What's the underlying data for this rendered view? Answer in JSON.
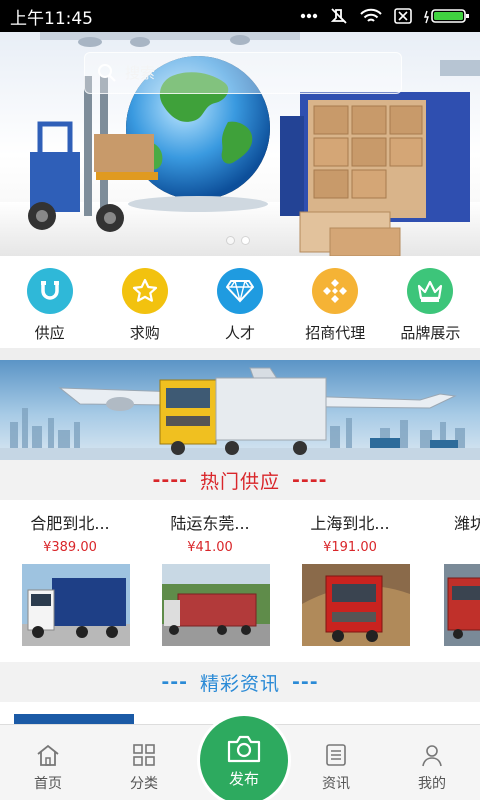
{
  "status_bar": {
    "time": "上午11:45"
  },
  "search": {
    "placeholder": "搜索"
  },
  "categories": [
    {
      "label": "供应",
      "color": "#2fb8d8",
      "icon": "magnet-icon"
    },
    {
      "label": "求购",
      "color": "#f2c20f",
      "icon": "star-icon"
    },
    {
      "label": "人才",
      "color": "#1f9be0",
      "icon": "diamond-icon"
    },
    {
      "label": "招商代理",
      "color": "#f5b335",
      "icon": "diamond-cluster-icon"
    },
    {
      "label": "品牌展示",
      "color": "#3dc57a",
      "icon": "crown-icon"
    }
  ],
  "hot_supply": {
    "title": "热门供应",
    "dash_left": "----",
    "dash_right": "----",
    "items": [
      {
        "name": "合肥到北...",
        "price": "¥389.00"
      },
      {
        "name": "陆运东莞...",
        "price": "¥41.00"
      },
      {
        "name": "上海到北...",
        "price": "¥191.00"
      },
      {
        "name": "潍坊",
        "price": ""
      }
    ]
  },
  "news": {
    "title": "精彩资讯",
    "dash_left": "---",
    "dash_right": "---"
  },
  "bottom_nav": {
    "home": "首页",
    "category": "分类",
    "publish": "发布",
    "news": "资讯",
    "mine": "我的"
  },
  "colors": {
    "accent_red": "#d9262a",
    "accent_blue": "#2a8ad6",
    "publish_green": "#2daa5f"
  }
}
